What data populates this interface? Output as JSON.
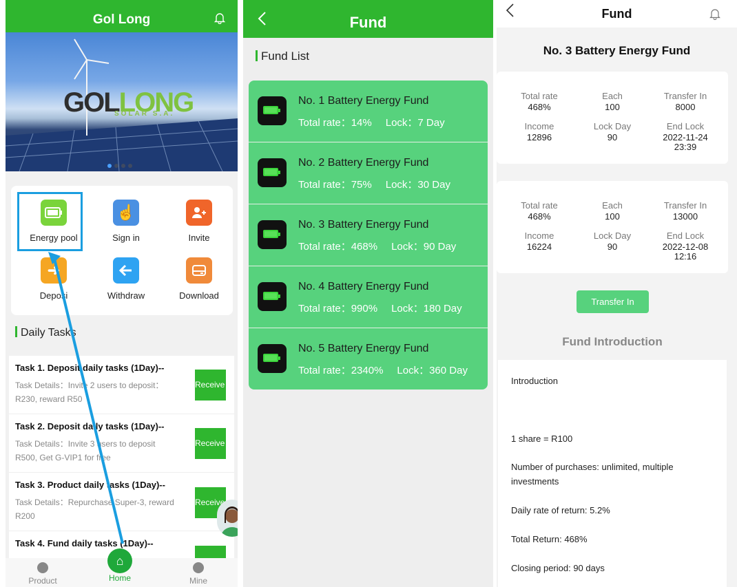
{
  "panel1": {
    "title": "Gol Long",
    "banner": {
      "logo_part1": "GOL",
      "logo_part2": "LONG",
      "logo_sub": "SOLAR S.A."
    },
    "menu": [
      {
        "label": "Energy pool",
        "icon": "battery-icon",
        "color": "#7ad43b"
      },
      {
        "label": "Sign in",
        "icon": "hand-pointer-icon",
        "color": "#4a90e2"
      },
      {
        "label": "Invite",
        "icon": "add-user-icon",
        "color": "#f0652a"
      },
      {
        "label": "Deposi",
        "icon": "arrow-right-icon",
        "color": "#f5a623"
      },
      {
        "label": "Withdraw",
        "icon": "arrow-left-icon",
        "color": "#2ea3f2"
      },
      {
        "label": "Download",
        "icon": "download-box-icon",
        "color": "#f08a3a"
      }
    ],
    "daily_tasks_heading": "Daily Tasks",
    "tasks": [
      {
        "title": "Task 1. Deposit daily tasks (1Day)--",
        "detail": "Task Details：Invite 2 users to deposit：R230, reward R50",
        "button": "Receive"
      },
      {
        "title": "Task 2. Deposit daily tasks (1Day)--",
        "detail": "Task Details：Invite 3 users to deposit R500, Get G-VIP1 for free",
        "button": "Receive"
      },
      {
        "title": "Task 3. Product daily tasks (1Day)--",
        "detail": "Task Details：Repurchase Super-3, reward R200",
        "button": "Receive"
      },
      {
        "title": "Task 4. Fund daily tasks (1Day)--",
        "detail": "",
        "button": ""
      }
    ],
    "nav": {
      "product": "Product",
      "home": "Home",
      "mine": "Mine"
    },
    "accent": "#2fb62f"
  },
  "panel2": {
    "title": "Fund",
    "list_heading": "Fund List",
    "funds": [
      {
        "name": "No. 1 Battery Energy Fund",
        "rate": "Total rate：14%",
        "lock": "Lock：7 Day"
      },
      {
        "name": "No. 2 Battery Energy Fund",
        "rate": "Total rate：75%",
        "lock": "Lock：30 Day"
      },
      {
        "name": "No. 3 Battery Energy Fund",
        "rate": "Total rate：468%",
        "lock": "Lock：90 Day"
      },
      {
        "name": "No. 4 Battery Energy Fund",
        "rate": "Total rate：990%",
        "lock": "Lock：180 Day"
      },
      {
        "name": "No. 5 Battery Energy Fund",
        "rate": "Total rate：2340%",
        "lock": "Lock：360 Day"
      }
    ],
    "card_color": "#57d27d"
  },
  "panel3": {
    "title": "Fund",
    "heading": "No. 3 Battery Energy Fund",
    "records": [
      {
        "total_rate_label": "Total rate",
        "total_rate": "468%",
        "each_label": "Each",
        "each": "100",
        "transfer_label": "Transfer In",
        "transfer": "8000",
        "income_label": "Income",
        "income": "12896",
        "lockday_label": "Lock Day",
        "lockday": "90",
        "endlock_label": "End Lock",
        "endlock_date": "2022-11-24",
        "endlock_time": "23:39"
      },
      {
        "total_rate_label": "Total rate",
        "total_rate": "468%",
        "each_label": "Each",
        "each": "100",
        "transfer_label": "Transfer In",
        "transfer": "13000",
        "income_label": "Income",
        "income": "16224",
        "lockday_label": "Lock Day",
        "lockday": "90",
        "endlock_label": "End Lock",
        "endlock_date": "2022-12-08",
        "endlock_time": "12:16"
      }
    ],
    "transfer_button": "Transfer In",
    "intro_heading": "Fund Introduction",
    "intro": {
      "title": "Introduction",
      "share": "1 share = R100",
      "purchases": "Number of purchases: unlimited, multiple investments",
      "daily_rate": "Daily rate of return: 5.2%",
      "total_return": "Total Return: 468%",
      "closing": "Closing period: 90 days"
    }
  }
}
